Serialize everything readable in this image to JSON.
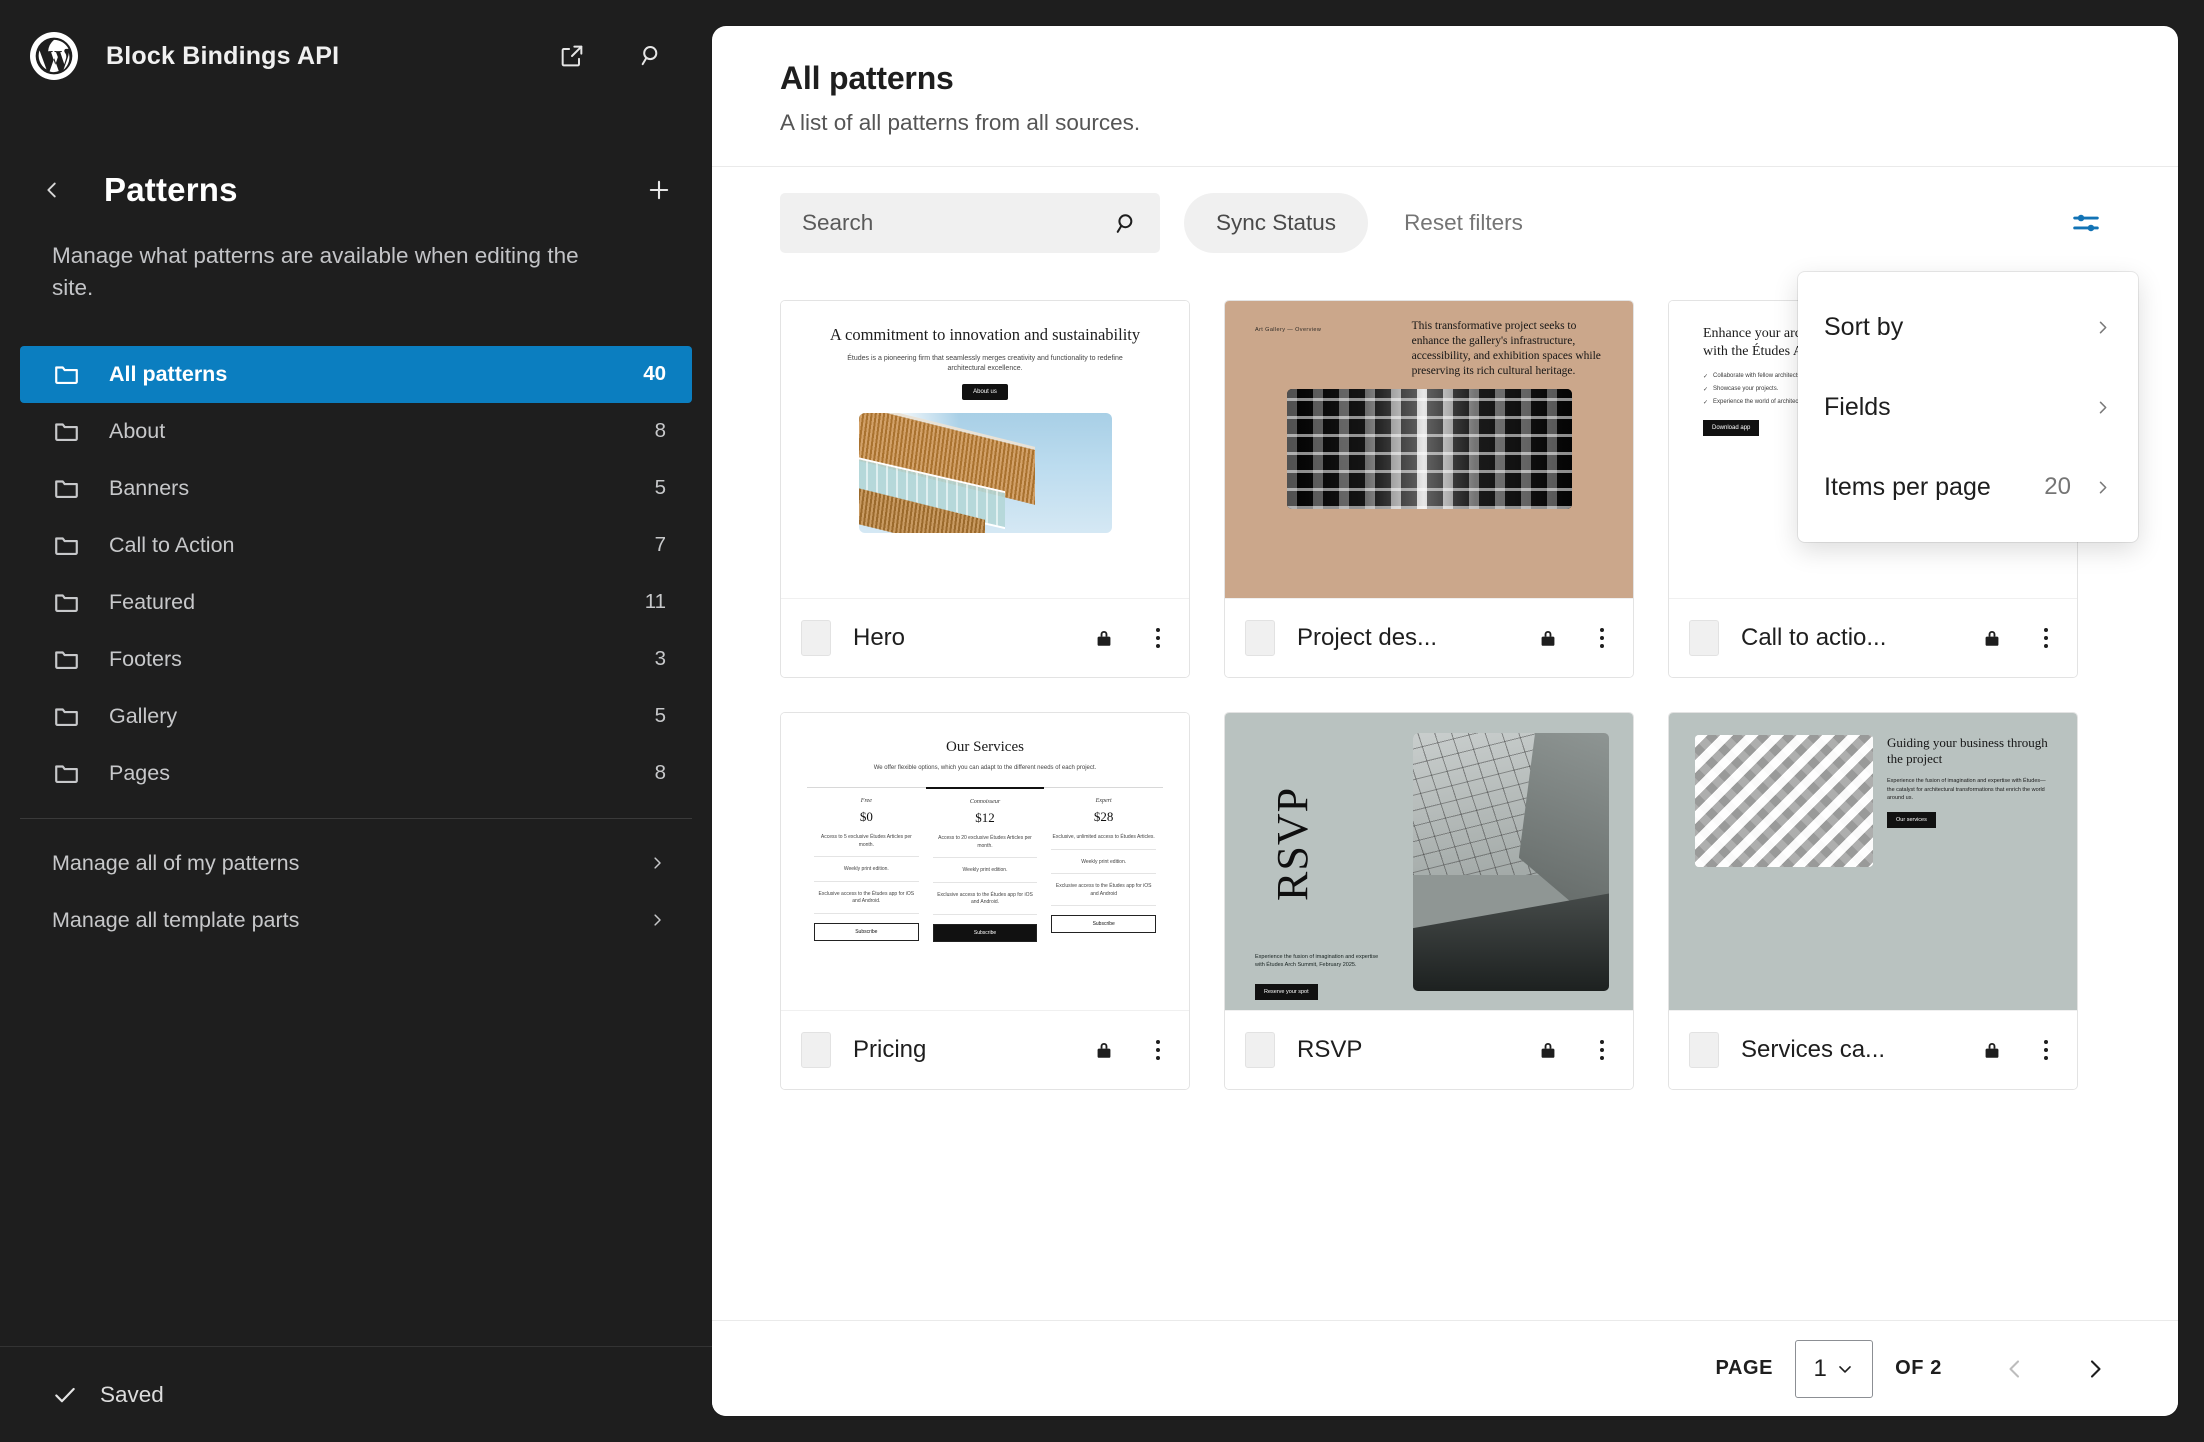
{
  "app": {
    "site_title": "Block Bindings API",
    "wp_logo_icon": "wordpress-logo-icon",
    "view_site_icon": "external-link-icon",
    "search_icon": "search-icon"
  },
  "sidebar": {
    "back_icon": "chevron-left-icon",
    "title": "Patterns",
    "add_icon": "plus-icon",
    "description": "Manage what patterns are available when editing the site.",
    "categories": [
      {
        "label": "All patterns",
        "count": "40",
        "icon": "folder-icon",
        "active": true
      },
      {
        "label": "About",
        "count": "8",
        "icon": "folder-icon",
        "active": false
      },
      {
        "label": "Banners",
        "count": "5",
        "icon": "folder-icon",
        "active": false
      },
      {
        "label": "Call to Action",
        "count": "7",
        "icon": "folder-icon",
        "active": false
      },
      {
        "label": "Featured",
        "count": "11",
        "icon": "folder-icon",
        "active": false
      },
      {
        "label": "Footers",
        "count": "3",
        "icon": "folder-icon",
        "active": false
      },
      {
        "label": "Gallery",
        "count": "5",
        "icon": "folder-icon",
        "active": false
      },
      {
        "label": "Pages",
        "count": "8",
        "icon": "folder-icon",
        "active": false
      }
    ],
    "manage_links": [
      {
        "label": "Manage all of my patterns",
        "icon": "chevron-right-icon"
      },
      {
        "label": "Manage all template parts",
        "icon": "chevron-right-icon"
      }
    ],
    "footer": {
      "status": "Saved",
      "icon": "check-icon"
    }
  },
  "main": {
    "title": "All patterns",
    "subtitle": "A list of all patterns from all sources.",
    "filters": {
      "search_placeholder": "Search",
      "search_value": "",
      "search_icon": "search-icon",
      "sync_status_label": "Sync Status",
      "reset_filters_label": "Reset filters",
      "view_options_icon": "sliders-icon"
    },
    "view_dropdown": {
      "items": [
        {
          "label": "Sort by",
          "value": "",
          "icon": "chevron-right-icon"
        },
        {
          "label": "Fields",
          "value": "",
          "icon": "chevron-right-icon"
        },
        {
          "label": "Items per page",
          "value": "20",
          "icon": "chevron-right-icon"
        }
      ]
    },
    "pagination": {
      "page_label": "PAGE",
      "current_page": "1",
      "of_label": "OF 2",
      "prev_icon": "chevron-left-icon",
      "next_icon": "chevron-right-icon",
      "select_icon": "chevron-down-icon"
    }
  },
  "patterns": [
    {
      "title": "Hero",
      "lock_icon": "lock-icon",
      "menu_icon": "more-vertical-icon",
      "checkbox": "pattern-checkbox",
      "preview": {
        "kind": "hero",
        "heading": "A commitment to innovation and sustainability",
        "body": "Études is a pioneering firm that seamlessly merges creativity and functionality to redefine architectural excellence.",
        "button": "About us"
      }
    },
    {
      "title": "Project des...",
      "lock_icon": "lock-icon",
      "menu_icon": "more-vertical-icon",
      "checkbox": "pattern-checkbox",
      "preview": {
        "kind": "project",
        "eyebrow": "Art Gallery — Overview",
        "body": "This transformative project seeks to enhance the gallery's infrastructure, accessibility, and exhibition spaces while preserving its rich cultural heritage."
      }
    },
    {
      "title": "Call to actio...",
      "lock_icon": "lock-icon",
      "menu_icon": "more-vertical-icon",
      "checkbox": "pattern-checkbox",
      "preview": {
        "kind": "cta",
        "heading": "Enhance your architectural journey with the Études Architect App",
        "bullets": [
          "Collaborate with fellow architects.",
          "Showcase your projects.",
          "Experience the world of architecture."
        ],
        "button": "Download app"
      }
    },
    {
      "title": "Pricing",
      "lock_icon": "lock-icon",
      "menu_icon": "more-vertical-icon",
      "checkbox": "pattern-checkbox",
      "preview": {
        "kind": "pricing",
        "heading": "Our Services",
        "subheading": "We offer flexible options, which you can adapt to the different needs of each project.",
        "tiers": [
          {
            "name": "Free",
            "price": "$0",
            "features": [
              "Access to 5 exclusive Études Articles per month.",
              "Weekly print edition.",
              "Exclusive access to the Études app for iOS and Android."
            ],
            "button": "Subscribe",
            "highlight": false
          },
          {
            "name": "Connoisseur",
            "price": "$12",
            "features": [
              "Access to 20 exclusive Études Articles per month.",
              "Weekly print edition.",
              "Exclusive access to the Études app for iOS and Android."
            ],
            "button": "Subscribe",
            "highlight": true
          },
          {
            "name": "Expert",
            "price": "$28",
            "features": [
              "Exclusive, unlimited access to Études Articles.",
              "Weekly print edition.",
              "Exclusive access to the Études app for iOS and Android"
            ],
            "button": "Subscribe",
            "highlight": false
          }
        ]
      }
    },
    {
      "title": "RSVP",
      "lock_icon": "lock-icon",
      "menu_icon": "more-vertical-icon",
      "checkbox": "pattern-checkbox",
      "preview": {
        "kind": "rsvp",
        "word": "RSVP",
        "body": "Experience the fusion of imagination and expertise with Études Arch Summit, February 2025.",
        "button": "Reserve your spot"
      }
    },
    {
      "title": "Services ca...",
      "lock_icon": "lock-icon",
      "menu_icon": "more-vertical-icon",
      "checkbox": "pattern-checkbox",
      "preview": {
        "kind": "services",
        "heading": "Guiding your business through the project",
        "body": "Experience the fusion of imagination and expertise with Études—the catalyst for architectural transformations that enrich the world around us.",
        "button": "Our services"
      }
    }
  ],
  "colors": {
    "accent_blue": "#0b7ec0",
    "sidebar_bg": "#1e1e1e",
    "panel_bg": "#ffffff",
    "project_card_bg": "#cba78b",
    "rsvp_card_bg": "#b9c2c0"
  }
}
